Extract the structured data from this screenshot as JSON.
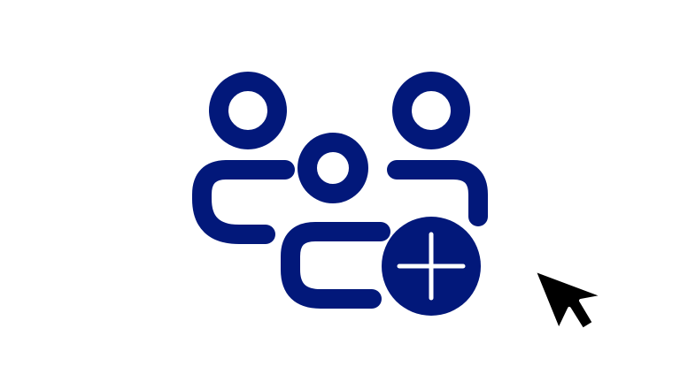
{
  "scene": {
    "background_color": "#ffffff",
    "icon": {
      "name": "add-group-icon",
      "color": "#02187a",
      "plus_color": "#ffffff"
    },
    "cursor": {
      "name": "mouse-pointer-icon",
      "fill": "#000000",
      "outline": "#ffffff"
    }
  }
}
